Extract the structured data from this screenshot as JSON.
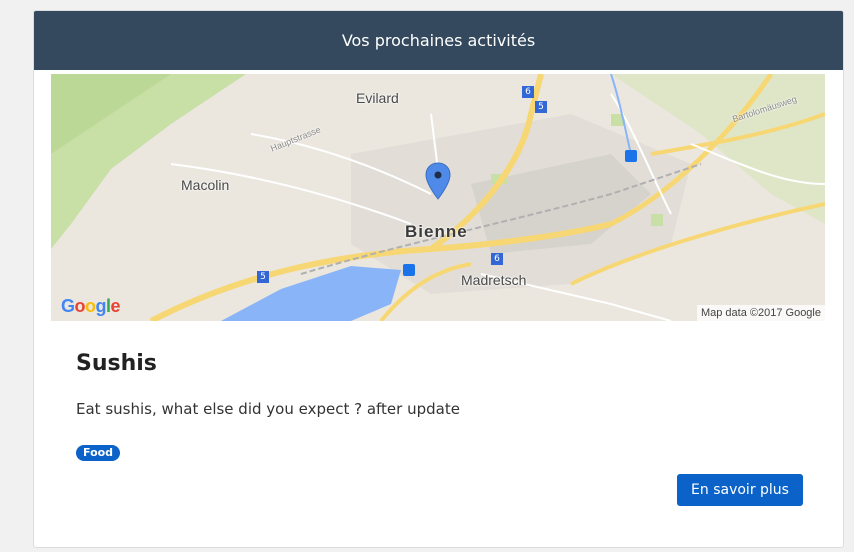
{
  "card": {
    "header_title": "Vos prochaines activités"
  },
  "map": {
    "labels": {
      "evilard": "Evilard",
      "macolin": "Macolin",
      "bienne": "Bienne",
      "madretsch": "Madretsch",
      "hauptstrasse": "Hauptstrasse",
      "bartolomausweg": "Bartolomäusweg"
    },
    "route_shields": [
      "6",
      "5",
      "6",
      "5"
    ],
    "logo": "Google",
    "attribution": "Map data ©2017 Google",
    "marker_icon": "map-pin-icon",
    "colors": {
      "land": "#ebe7df",
      "forest": "#c8dfa6",
      "water": "#8ab4f8",
      "highway": "#f7d774",
      "marker": "#4f8ae8"
    }
  },
  "activity": {
    "title": "Sushis",
    "description": "Eat sushis, what else did you expect ? after update",
    "tag": "Food",
    "more_button": "En savoir plus"
  },
  "colors": {
    "header_bg": "#34495e",
    "primary": "#0b63c9"
  }
}
